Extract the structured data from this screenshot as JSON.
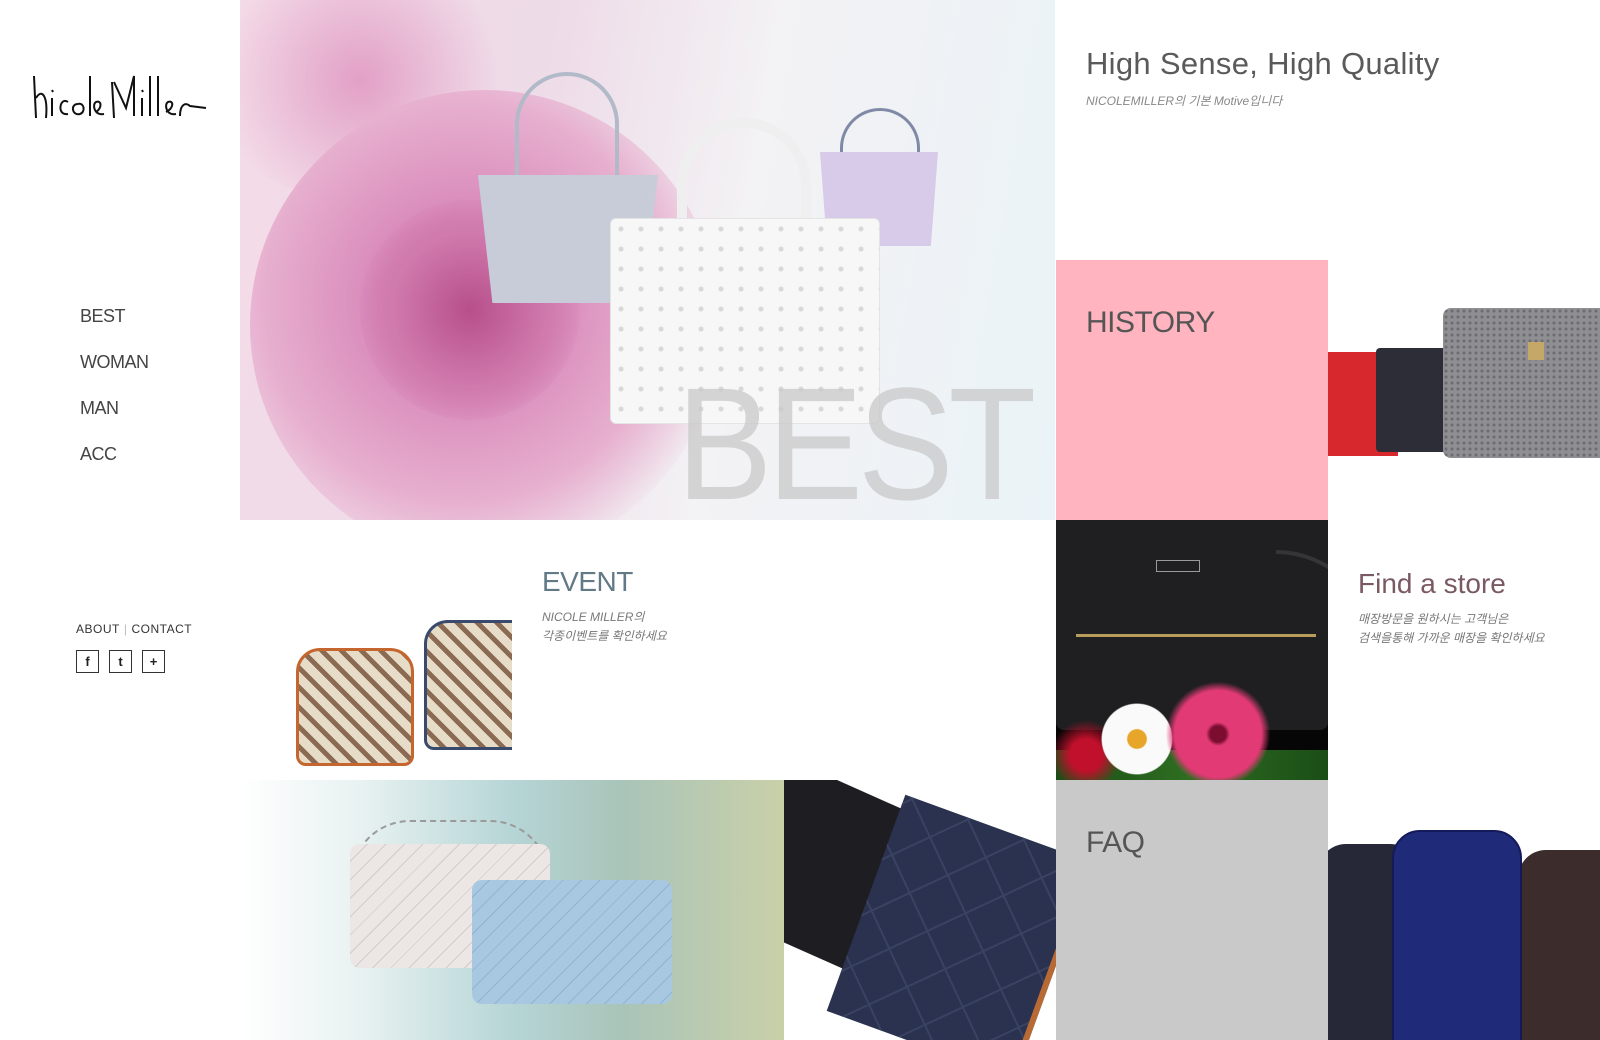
{
  "brand": {
    "logo_text": "nicole miller"
  },
  "nav": {
    "items": [
      {
        "label": "BEST"
      },
      {
        "label": "WOMAN"
      },
      {
        "label": "MAN"
      },
      {
        "label": "ACC"
      }
    ]
  },
  "footer": {
    "about_label": "ABOUT",
    "separator": "|",
    "contact_label": "CONTACT",
    "social": [
      {
        "icon": "facebook-icon",
        "glyph": "f"
      },
      {
        "icon": "twitter-icon",
        "glyph": "t"
      },
      {
        "icon": "plus-icon",
        "glyph": "+"
      }
    ]
  },
  "hero": {
    "overlay_text": "BEST"
  },
  "tagline": {
    "title": "High Sense, High Quality",
    "subtitle": "NICOLEMILLER의 기본 Motive입니다"
  },
  "history": {
    "label": "HISTORY",
    "color": "#ffb4c0"
  },
  "event": {
    "title": "EVENT",
    "desc_line1": "NICOLE MILLER의",
    "desc_line2": "각종이벤트를 확인하세요"
  },
  "store": {
    "title": "Find a store",
    "desc_line1": "매장방문을 원하시는 고객님은",
    "desc_line2": "검색을통해 가까운 매장을 확인하세요"
  },
  "faq": {
    "label": "FAQ",
    "color": "#c9c9c9"
  }
}
